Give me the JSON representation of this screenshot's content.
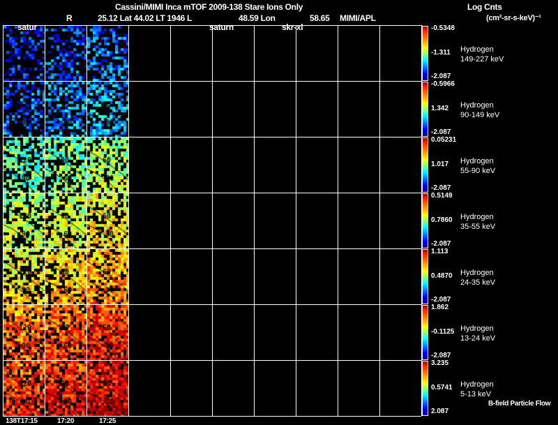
{
  "header": {
    "title": "Cassini/MIMI Inca mTOF  2009-138   Stare   Ions Only",
    "r_label": "R",
    "position_line": "25.12 Lat 44.02 LT 1946 L",
    "lon_value": "48.59 Lon",
    "lon_value2": "58.65",
    "credit": "MIMI/APL",
    "marker_labels": [
      "satur",
      "saturn",
      "skr-xl"
    ],
    "units_line1": "Log Cnts",
    "units_line2": "(cm²-sr-s-keV)⁻¹"
  },
  "chart_data": {
    "type": "heatmap",
    "title": "Cassini/MIMI Inca mTOF  2009-138   Stare   Ions Only",
    "colorbar_label": "Log Cnts (cm²-sr-s-keV)⁻¹",
    "time_labels": [
      "138T17:15",
      "17:20",
      "17:25"
    ],
    "columns_total": 10,
    "columns_with_data": 3,
    "rows": [
      {
        "species": "Hydrogen",
        "energy": "149-227 keV",
        "max": "-0.5348",
        "mid": "-1.311",
        "min": "-2.087",
        "level": 0.15
      },
      {
        "species": "Hydrogen",
        "energy": "90-149 keV",
        "max": "-0.5966",
        "mid": "1.342",
        "min": "-2.087",
        "level": 0.22
      },
      {
        "species": "Hydrogen",
        "energy": "55-90 keV",
        "max": "0.05231",
        "mid": "1.017",
        "min": "-2.087",
        "level": 0.42
      },
      {
        "species": "Hydrogen",
        "energy": "35-55 keV",
        "max": "0.5149",
        "mid": "0.7860",
        "min": "-2.087",
        "level": 0.52
      },
      {
        "species": "Hydrogen",
        "energy": "24-35 keV",
        "max": "1.113",
        "mid": "0.4870",
        "min": "-2.087",
        "level": 0.6
      },
      {
        "species": "Hydrogen",
        "energy": "13-24 keV",
        "max": "1.862",
        "mid": "-0.1125",
        "min": "-2.087",
        "level": 0.72
      },
      {
        "species": "Hydrogen",
        "energy": "5-13 keV",
        "max": "3.235",
        "mid": "0.5741",
        "min": "2.087",
        "level": 0.78
      }
    ],
    "footer_label": "B-field Particle Flow"
  }
}
